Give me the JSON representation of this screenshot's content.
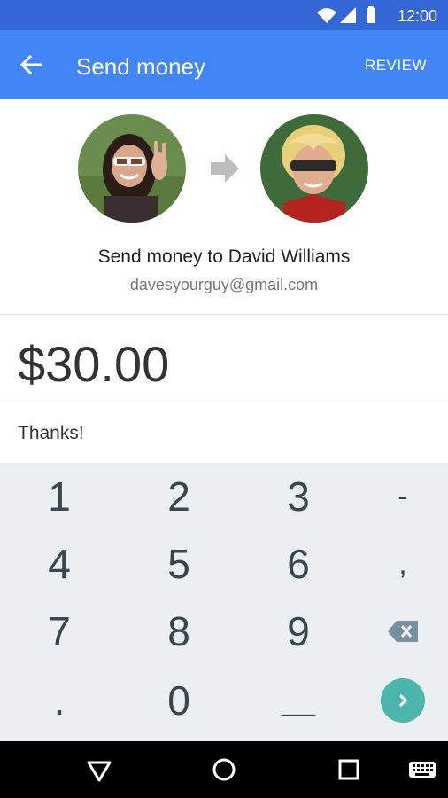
{
  "status_bar": {
    "time": "12:00",
    "icons": [
      "wifi-icon",
      "signal-icon",
      "battery-icon"
    ]
  },
  "toolbar": {
    "title": "Send money",
    "action": "REVIEW"
  },
  "transfer": {
    "recipient_line": "Send money to David Williams",
    "recipient_email": "davesyourguy@gmail.com"
  },
  "amount": "$30.00",
  "note": "Thanks!",
  "keypad": {
    "row1": [
      "1",
      "2",
      "3",
      "-"
    ],
    "row2": [
      "4",
      "5",
      "6",
      ","
    ],
    "row3": [
      "7",
      "8",
      "9"
    ],
    "row4": [
      ".",
      "0",
      "__"
    ],
    "backspace_icon": "backspace-icon",
    "next_icon": "chevron-right-icon"
  },
  "nav_bar": [
    "back-triangle-icon",
    "home-circle-icon",
    "recents-square-icon",
    "keyboard-icon"
  ],
  "colors": {
    "primary": "#4285f4",
    "status": "#3367d6",
    "accent": "#4db6ac",
    "keypad_bg": "#eceff1"
  }
}
